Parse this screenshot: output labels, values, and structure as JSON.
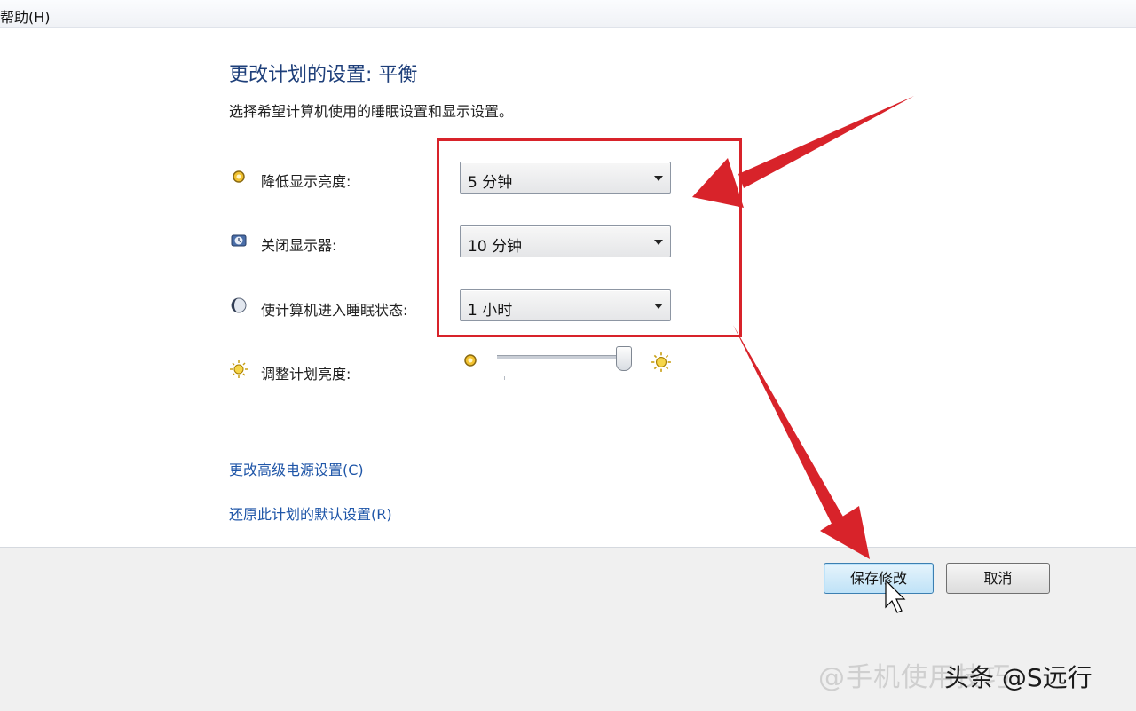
{
  "menu": {
    "help": "帮助(H)"
  },
  "header": {
    "title": "更改计划的设置: 平衡",
    "subtitle": "选择希望计算机使用的睡眠设置和显示设置。"
  },
  "settings": [
    {
      "label": "降低显示亮度:",
      "value": "5 分钟",
      "icon": "dim-brightness-icon"
    },
    {
      "label": "关闭显示器:",
      "value": "10 分钟",
      "icon": "monitor-off-icon"
    },
    {
      "label": "使计算机进入睡眠状态:",
      "value": "1 小时",
      "icon": "sleep-moon-icon"
    }
  ],
  "brightness": {
    "label": "调整计划亮度:",
    "level_percent": 95
  },
  "links": {
    "advanced": "更改高级电源设置(C)",
    "restore": "还原此计划的默认设置(R)"
  },
  "buttons": {
    "save": "保存修改",
    "cancel": "取消"
  },
  "watermark": {
    "faded": "@手机使用技巧",
    "front": "头条 @S远行"
  },
  "colors": {
    "annotation": "#d8232a",
    "title": "#1e3f7a",
    "link": "#1f56a8"
  }
}
